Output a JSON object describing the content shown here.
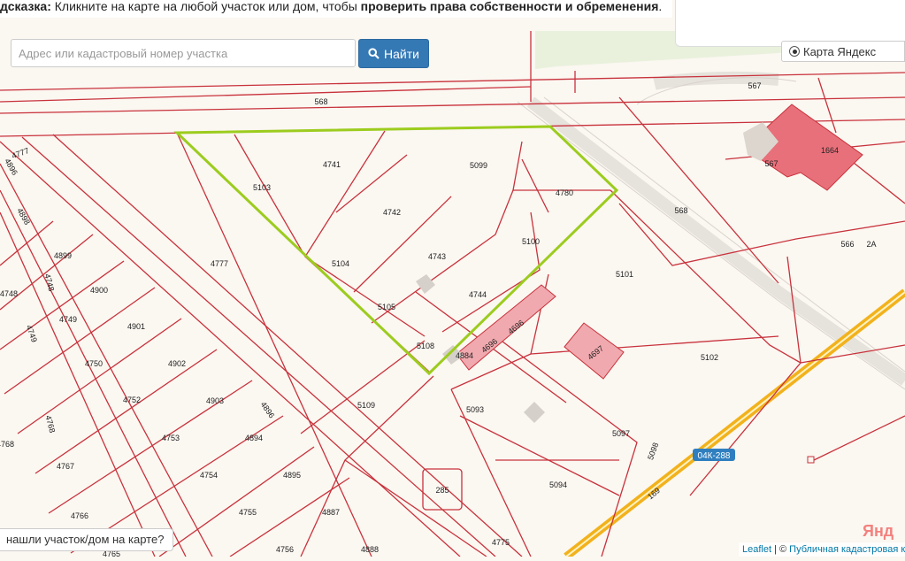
{
  "hint": {
    "prefix": "дсказка:",
    "text": " Кликните на карте на любой участок или дом, чтобы ",
    "bold": "проверить права собственности и обременения",
    "suffix": "."
  },
  "search": {
    "placeholder": "Адрес или кадастровый номер участка",
    "button_label": "Найти",
    "button_icon": "search-icon"
  },
  "layer": {
    "label": "Карта Яндекс"
  },
  "not_found_label": "нашли участок/дом на карте?",
  "attribution": {
    "leaflet": "Leaflet",
    "sep": " | © ",
    "source": "Публичная кадастровая ка"
  },
  "yandex_mark": "Янд",
  "road_sign": "04К-288",
  "map_labels": {
    "568": "568",
    "567": "567",
    "566": "566",
    "2A": "2А",
    "5103": "5103",
    "4741": "4741",
    "5099": "5099",
    "4780": "4780",
    "4742": "4742",
    "5104": "5104",
    "4743": "4743",
    "5100": "5100",
    "4777": "4777",
    "4744": "4744",
    "5105": "5105",
    "5108": "5108",
    "4884": "4884",
    "4696": "4696",
    "4697": "4697",
    "5101": "5101",
    "5102": "5102",
    "5109": "5109",
    "5093": "5093",
    "5097": "5097",
    "5098": "5098",
    "5094": "5094",
    "285": "285",
    "4775": "4775",
    "169": "169",
    "1664": "1664",
    "4896": "4896",
    "4898": "4898",
    "4899": "4899",
    "4748": "4748",
    "4900": "4900",
    "4749": "4749",
    "4901": "4901",
    "4750": "4750",
    "4902": "4902",
    "4752": "4752",
    "4903": "4903",
    "4753": "4753",
    "4894": "4894",
    "4768": "4768",
    "4767": "4767",
    "4754": "4754",
    "4895": "4895",
    "4766": "4766",
    "4755": "4755",
    "4887": "4887",
    "4756": "4756",
    "4888": "4888",
    "4765": "4765"
  },
  "colors": {
    "parcel_line": "#c8323c",
    "highlight": "#9ccc1e",
    "building": "#e8707a",
    "road": "#f2b21c",
    "button": "#3478b4"
  }
}
